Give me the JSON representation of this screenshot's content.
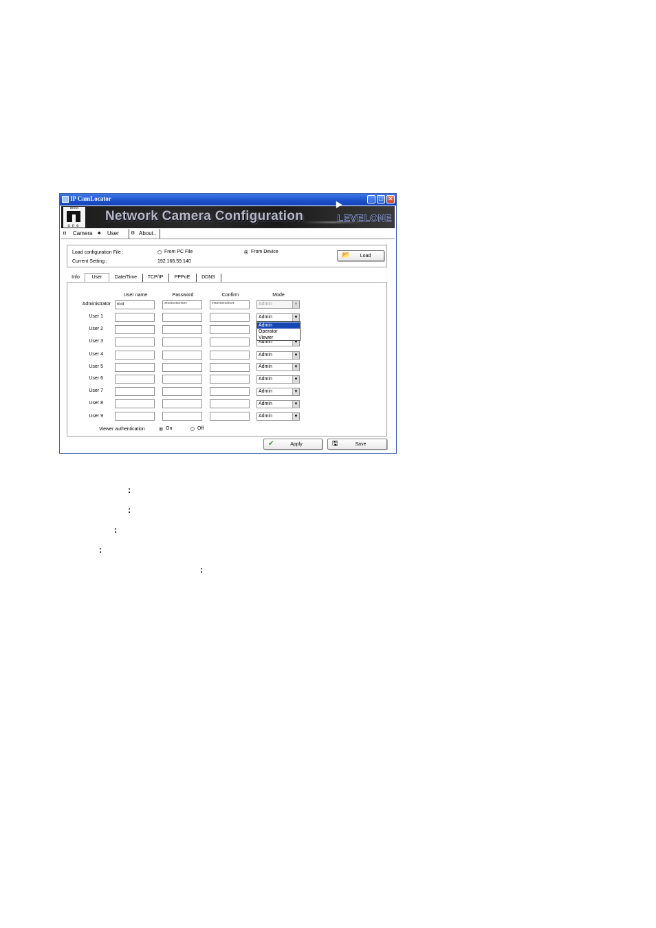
{
  "window": {
    "title": "IP CamLocator",
    "min_icon": "minimize-icon",
    "max_icon": "maximize-icon",
    "close_icon": "close-icon"
  },
  "banner": {
    "logo_top": "level",
    "logo_bottom": "one",
    "headline": "Network Camera Configuration",
    "brand": "LEVELONE"
  },
  "main_tabs": [
    {
      "label": "Camera",
      "icon": "camera-icon"
    },
    {
      "label": "User",
      "icon": "users-icon"
    },
    {
      "label": "About..",
      "icon": "info-icon"
    }
  ],
  "config": {
    "load_label": "Load configuration File :",
    "current_label": "Current Setting :",
    "current_value": "192.168.59.140",
    "source_options": [
      {
        "label": "From PC File",
        "selected": false
      },
      {
        "label": "From Device",
        "selected": true
      }
    ],
    "load_button": "Load"
  },
  "sub_tabs": [
    "Info",
    "User",
    "Date/Time",
    "TCP/IP",
    "PPPoE",
    "DDNS"
  ],
  "active_sub_tab": "User",
  "columns": {
    "username": "User name",
    "password": "Password",
    "confirm": "Confirm",
    "mode": "Mode"
  },
  "rows": [
    {
      "label": "Administrator",
      "username": "root",
      "password": "**************",
      "confirm": "**************",
      "mode": "Admin",
      "disabled": true
    },
    {
      "label": "User 1",
      "username": "",
      "password": "",
      "confirm": "",
      "mode": "Admin"
    },
    {
      "label": "User 2",
      "username": "",
      "password": "",
      "confirm": "",
      "mode": "Admin"
    },
    {
      "label": "User 3",
      "username": "",
      "password": "",
      "confirm": "",
      "mode": "Admin"
    },
    {
      "label": "User 4",
      "username": "",
      "password": "",
      "confirm": "",
      "mode": "Admin"
    },
    {
      "label": "User 5",
      "username": "",
      "password": "",
      "confirm": "",
      "mode": "Admin"
    },
    {
      "label": "User 6",
      "username": "",
      "password": "",
      "confirm": "",
      "mode": "Admin"
    },
    {
      "label": "User 7",
      "username": "",
      "password": "",
      "confirm": "",
      "mode": "Admin"
    },
    {
      "label": "User 8",
      "username": "",
      "password": "",
      "confirm": "",
      "mode": "Admin"
    },
    {
      "label": "User 9",
      "username": "",
      "password": "",
      "confirm": "",
      "mode": "Admin"
    }
  ],
  "dropdown_options": [
    "Admin",
    "Operator",
    "Viewer"
  ],
  "dropdown_highlighted": "Admin",
  "viewer_auth": {
    "label": "Viewer authentication",
    "on": "On",
    "off": "Off",
    "selected": "On"
  },
  "buttons": {
    "apply": "Apply",
    "save": "Save"
  },
  "doc_colons": [
    ":",
    ":",
    ":",
    ":",
    ":"
  ]
}
